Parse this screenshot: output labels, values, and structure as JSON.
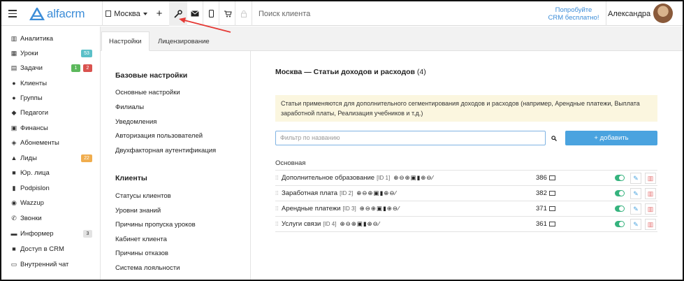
{
  "topbar": {
    "logo": "alfacrm",
    "city": "Москва",
    "search_placeholder": "Поиск клиента",
    "try_line1": "Попробуйте",
    "try_line2": "CRM бесплатно!",
    "user_name": "Александра"
  },
  "sidebar": {
    "items": [
      {
        "label": "Аналитика",
        "icon": "book-icon"
      },
      {
        "label": "Уроки",
        "icon": "calendar-icon",
        "badge": "53"
      },
      {
        "label": "Задачи",
        "icon": "tasks-icon",
        "badge1": "1",
        "badge2": "2"
      },
      {
        "label": "Клиенты",
        "icon": "user-icon"
      },
      {
        "label": "Группы",
        "icon": "group-icon"
      },
      {
        "label": "Педагоги",
        "icon": "graduation-cap-icon"
      },
      {
        "label": "Финансы",
        "icon": "money-icon"
      },
      {
        "label": "Абонементы",
        "icon": "tag-icon"
      },
      {
        "label": "Лиды",
        "icon": "thumbs-up-icon",
        "badge": "22"
      },
      {
        "label": "Юр. лица",
        "icon": "briefcase-icon"
      },
      {
        "label": "Podpislon",
        "icon": "document-icon"
      },
      {
        "label": "Wazzup",
        "icon": "whatsapp-icon"
      },
      {
        "label": "Звонки",
        "icon": "phone-icon"
      },
      {
        "label": "Информер",
        "icon": "monitor-icon",
        "badge": "3"
      },
      {
        "label": "Доступ в CRM",
        "icon": "lock-icon"
      },
      {
        "label": "Внутренний чат",
        "icon": "chat-icon"
      }
    ]
  },
  "tabs": [
    "Настройки",
    "Лицензирование"
  ],
  "menu": {
    "section1": "Базовые настройки",
    "items1": [
      "Основные настройки",
      "Филиалы",
      "Уведомления",
      "Авторизация пользователей",
      "Двухфакторная аутентификация"
    ],
    "section2": "Клиенты",
    "items2": [
      "Статусы клиентов",
      "Уровни знаний",
      "Причины пропуска уроков",
      "Кабинет клиента",
      "Причины отказов",
      "Система лояльности"
    ]
  },
  "main": {
    "title": "Москва — Статьи доходов и расходов",
    "title_count": "(4)",
    "notice": "Статьи применяются для дополнительного сегментирования доходов и расходов (например, Арендные платежи, Выплата заработной платы, Реализация учебников и т.д.)",
    "filter_placeholder": "Фильтр по названию",
    "add_label": "+ добавить",
    "group": "Основная",
    "rows": [
      {
        "name": "Дополнительное образование",
        "id": "[ID 1]",
        "icons": "⊕⊖⊕▣▮⊕⊖⁄",
        "count": "386"
      },
      {
        "name": "Заработная плата",
        "id": "[ID 2]",
        "icons": "⊕⊖⊕▣▮⊕⊖⁄",
        "count": "382"
      },
      {
        "name": "Арендные платежи",
        "id": "[ID 3]",
        "icons": "⊕⊖⊕▣▮⊕⊖⁄",
        "count": "371"
      },
      {
        "name": "Услуги связи",
        "id": "[ID 4]",
        "icons": "⊕⊖⊕▣▮⊕⊖⁄",
        "count": "361"
      }
    ]
  },
  "colors": {
    "accent": "#4aa3df",
    "toggle": "#36b37e",
    "notice_bg": "#fbf6df",
    "arrow": "#e53935"
  }
}
